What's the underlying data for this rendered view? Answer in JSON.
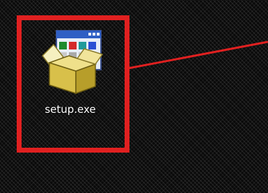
{
  "desktop": {
    "icon": {
      "label": "setup.exe",
      "icon_name": "installer-box-icon"
    },
    "annotation": {
      "box_color": "#e02020",
      "line_color": "#e02020"
    }
  }
}
